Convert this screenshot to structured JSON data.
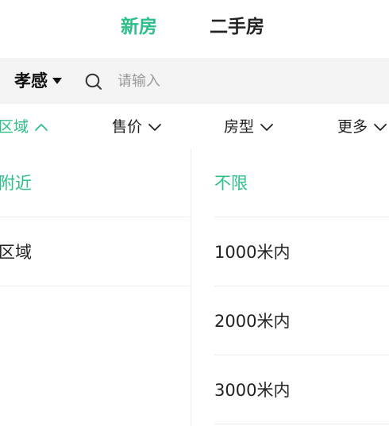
{
  "top_tabs": [
    {
      "label": "新房",
      "active": true
    },
    {
      "label": "二手房",
      "active": false
    }
  ],
  "search": {
    "city": "孝感",
    "placeholder": "请输入",
    "value": ""
  },
  "filters": [
    {
      "label": "区域",
      "active": true,
      "chevron": "chevron-up-icon"
    },
    {
      "label": "售价",
      "active": false,
      "chevron": "chevron-down-icon"
    },
    {
      "label": "房型",
      "active": false,
      "chevron": "chevron-down-icon"
    },
    {
      "label": "更多",
      "active": false,
      "chevron": "chevron-down-icon"
    }
  ],
  "area_categories": [
    {
      "label": "附近",
      "active": true
    },
    {
      "label": "区域",
      "active": false
    }
  ],
  "distance_options": [
    {
      "label": "不限",
      "active": true
    },
    {
      "label": "1000米内",
      "active": false
    },
    {
      "label": "2000米内",
      "active": false
    },
    {
      "label": "3000米内",
      "active": false
    }
  ],
  "colors": {
    "accent": "#2cc088",
    "text": "#222222",
    "placeholder": "#9a9a9a",
    "search_bg": "#f4f4f4"
  }
}
